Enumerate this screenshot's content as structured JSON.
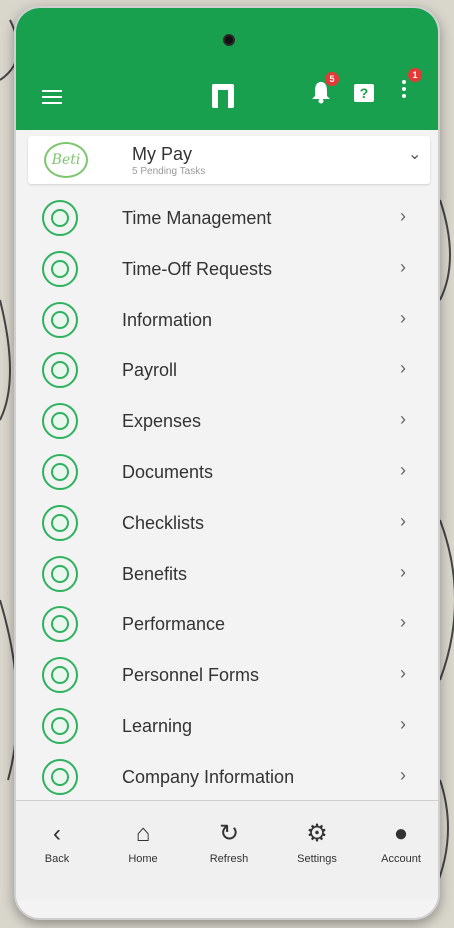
{
  "header": {
    "notification_count": "5",
    "menu_badge": "1",
    "help_symbol": "?"
  },
  "pay": {
    "avatar_text": "Beti",
    "title": "My Pay",
    "subtitle": "5 Pending Tasks",
    "chevron": "⌄"
  },
  "menu": [
    {
      "label": "Time Management",
      "icon": "clock-icon"
    },
    {
      "label": "Time-Off Requests",
      "icon": "time-off-icon"
    },
    {
      "label": "Information",
      "icon": "fingerprint-icon"
    },
    {
      "label": "Payroll",
      "icon": "dollar-icon"
    },
    {
      "label": "Expenses",
      "icon": "credit-card-icon"
    },
    {
      "label": "Documents",
      "icon": "document-icon"
    },
    {
      "label": "Checklists",
      "icon": "checklist-icon"
    },
    {
      "label": "Benefits",
      "icon": "plus-cross-icon"
    },
    {
      "label": "Performance",
      "icon": "rocket-icon"
    },
    {
      "label": "Personnel Forms",
      "icon": "arrows-icon"
    },
    {
      "label": "Learning",
      "icon": "lightbulb-icon"
    },
    {
      "label": "Company Information",
      "icon": "info-icon"
    }
  ],
  "menu_chevron": "›",
  "nav": {
    "back": "Back",
    "home": "Home",
    "refresh": "Refresh",
    "settings": "Settings",
    "account": "Account"
  },
  "colors": {
    "brand_green": "#18a04f",
    "icon_green": "#2db35d",
    "badge_red": "#e53935"
  }
}
